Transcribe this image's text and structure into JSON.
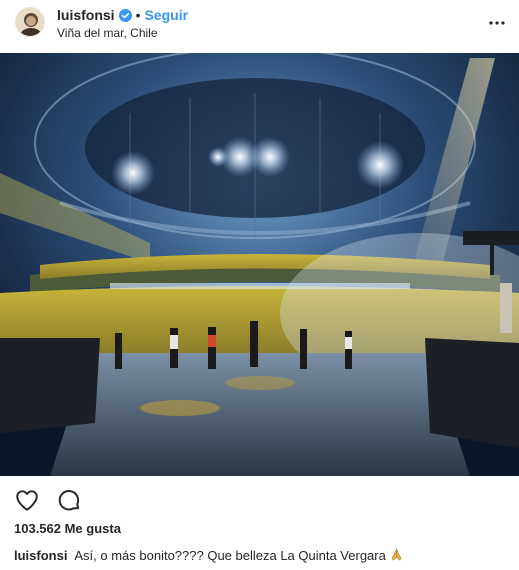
{
  "post": {
    "username": "luisfonsi",
    "follow_label": "Seguir",
    "separator": "•",
    "location": "Viña del mar, Chile",
    "likes_text": "103.562 Me gusta",
    "caption_user": "luisfonsi",
    "caption_text": "Así, o más bonito???? Que belleza La Quinta Vergara"
  },
  "icons": {
    "verified": "verified-badge-icon",
    "more": "more-options-icon",
    "like": "heart-icon",
    "comment": "comment-bubble-icon",
    "emoji": "folded-hands-emoji"
  },
  "colors": {
    "follow_blue": "#3897f0",
    "verified_blue": "#3897f0",
    "text": "#262626"
  }
}
